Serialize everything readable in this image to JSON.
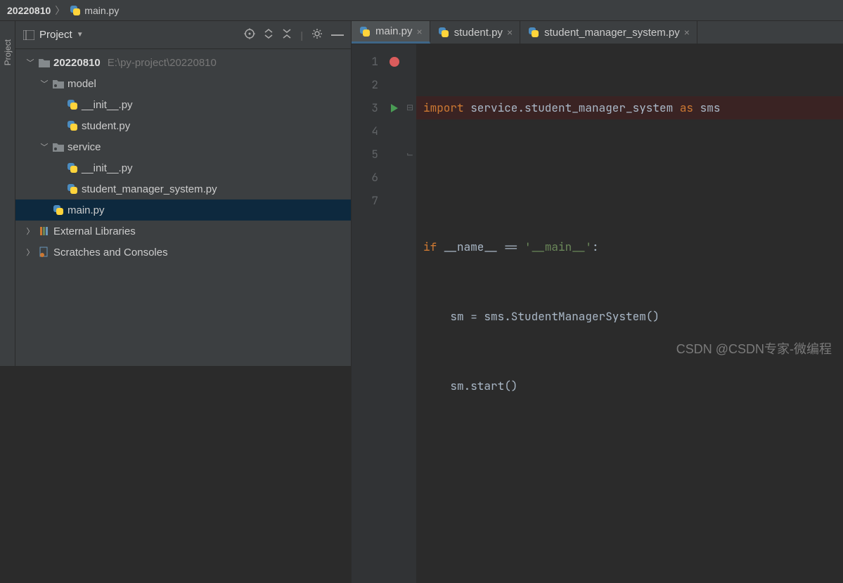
{
  "breadcrumb": {
    "root": "20220810",
    "file": "main.py"
  },
  "sidebar": {
    "title": "Project",
    "side_label": "Project",
    "tree": {
      "root": {
        "name": "20220810",
        "path": "E:\\py-project\\20220810"
      },
      "model": {
        "name": "model"
      },
      "model_init": {
        "name": "__init__.py"
      },
      "model_student": {
        "name": "student.py"
      },
      "service": {
        "name": "service"
      },
      "service_init": {
        "name": "__init__.py"
      },
      "service_sms": {
        "name": "student_manager_system.py"
      },
      "main": {
        "name": "main.py"
      },
      "ext_libs": {
        "name": "External Libraries"
      },
      "scratches": {
        "name": "Scratches and Consoles"
      }
    }
  },
  "tabs": [
    {
      "label": "main.py"
    },
    {
      "label": "student.py"
    },
    {
      "label": "student_manager_system.py"
    }
  ],
  "line_numbers": [
    "1",
    "2",
    "3",
    "4",
    "5",
    "6",
    "7"
  ],
  "code": {
    "l1_kw1": "import",
    "l1_mod": " service.student_manager_system ",
    "l1_kw2": "as",
    "l1_alias": " sms",
    "l3_prefix": "if",
    "l3_name": " __name__ == ",
    "l3_str": "'__main__'",
    "l3_colon": ":",
    "l4": "    sm = sms.StudentManagerSystem()",
    "l5": "    sm.start()"
  },
  "watermark": "CSDN @CSDN专家-微编程"
}
